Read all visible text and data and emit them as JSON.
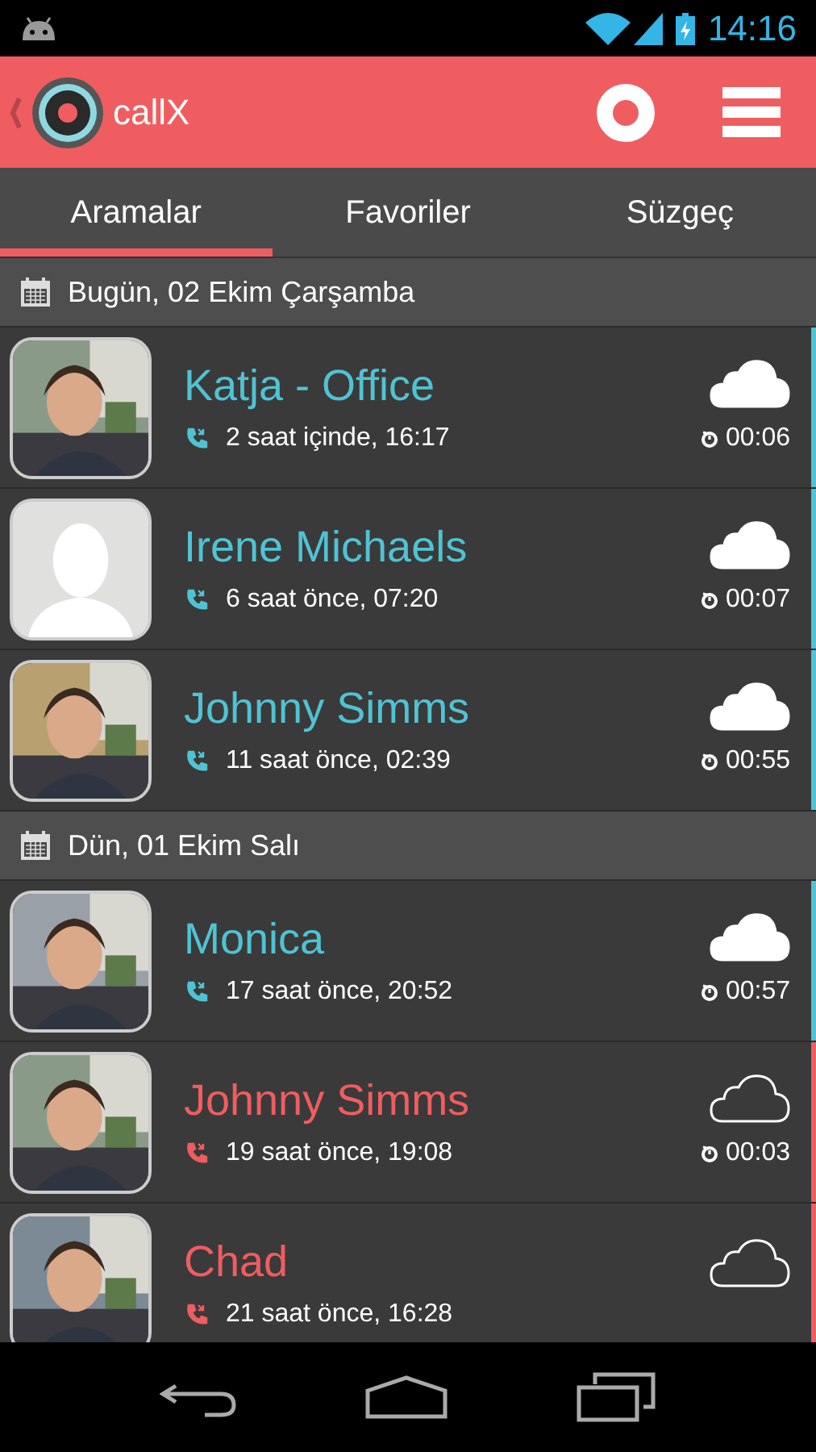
{
  "status_bar": {
    "time": "14:16"
  },
  "app_bar": {
    "title": "callX"
  },
  "tabs": [
    {
      "label": "Aramalar",
      "selected": true
    },
    {
      "label": "Favoriler",
      "selected": false
    },
    {
      "label": "Süzgeç",
      "selected": false
    }
  ],
  "sections": [
    {
      "date": "Bugün, 02 Ekim Çarşamba",
      "calls": [
        {
          "name": "Katja - Office",
          "time": "2 saat içinde, 16:17",
          "duration": "00:06",
          "color": "#4fc3d3",
          "synced": true,
          "kind": "picture"
        },
        {
          "name": "Irene Michaels",
          "time": "6 saat önce, 07:20",
          "duration": "00:07",
          "color": "#4fc3d3",
          "synced": true,
          "kind": "placeholder"
        },
        {
          "name": "Johnny Simms",
          "time": "11 saat önce, 02:39",
          "duration": "00:55",
          "color": "#4fc3d3",
          "synced": true,
          "kind": "picture"
        }
      ]
    },
    {
      "date": "Dün, 01 Ekim Salı",
      "calls": [
        {
          "name": "Monica",
          "time": "17 saat önce, 20:52",
          "duration": "00:57",
          "color": "#4fc3d3",
          "synced": true,
          "kind": "picture"
        },
        {
          "name": "Johnny Simms",
          "time": "19 saat önce, 19:08",
          "duration": "00:03",
          "color": "#ef5d60",
          "synced": false,
          "kind": "picture"
        },
        {
          "name": "Chad",
          "time": "21 saat önce, 16:28",
          "color": "#ef5d60",
          "synced": false,
          "kind": "picture"
        }
      ]
    }
  ]
}
